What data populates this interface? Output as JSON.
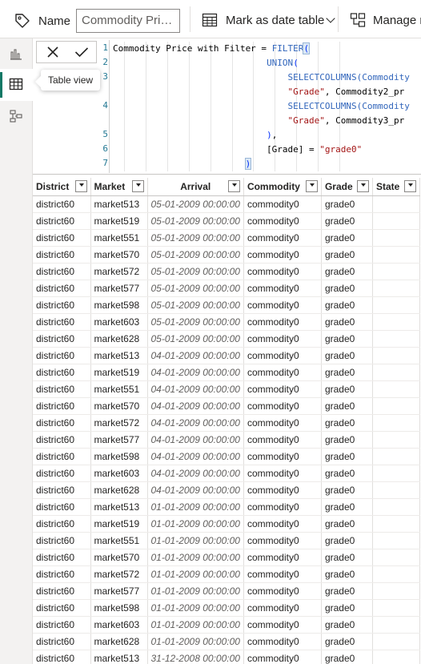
{
  "ribbon": {
    "name_label": "Name",
    "name_value": "Commodity Pri…",
    "mark_date_label": "Mark as date table",
    "manage_label": "Manage r"
  },
  "tooltip": "Table view",
  "formula": {
    "lines": [
      {
        "n": "1",
        "parts": [
          {
            "t": "Commodity Price with Filter = ",
            "c": ""
          },
          {
            "t": "FILTER",
            "c": "fn"
          },
          {
            "t": "(",
            "c": "paren bracket-hl"
          }
        ]
      },
      {
        "n": "2",
        "parts": [
          {
            "t": "                             ",
            "c": ""
          },
          {
            "t": "UNION",
            "c": "fn"
          },
          {
            "t": "(",
            "c": "paren"
          }
        ]
      },
      {
        "n": "3",
        "parts": [
          {
            "t": "                                 ",
            "c": ""
          },
          {
            "t": "SELECTCOLUMNS(Commodity",
            "c": "fn"
          }
        ]
      },
      {
        "n": "",
        "parts": [
          {
            "t": "                                 ",
            "c": ""
          },
          {
            "t": "\"Grade\"",
            "c": "str"
          },
          {
            "t": ", Commodity2_pr",
            "c": ""
          }
        ]
      },
      {
        "n": "4",
        "parts": [
          {
            "t": "                                 ",
            "c": ""
          },
          {
            "t": "SELECTCOLUMNS(Commodity",
            "c": "fn"
          }
        ]
      },
      {
        "n": "",
        "parts": [
          {
            "t": "                                 ",
            "c": ""
          },
          {
            "t": "\"Grade\"",
            "c": "str"
          },
          {
            "t": ", Commodity3_pr",
            "c": ""
          }
        ]
      },
      {
        "n": "5",
        "parts": [
          {
            "t": "                             ",
            "c": ""
          },
          {
            "t": ")",
            "c": "paren"
          },
          {
            "t": ",",
            "c": ""
          }
        ]
      },
      {
        "n": "6",
        "parts": [
          {
            "t": "                             ",
            "c": ""
          },
          {
            "t": "[Grade] = ",
            "c": ""
          },
          {
            "t": "\"grade0\"",
            "c": "str"
          }
        ]
      },
      {
        "n": "7",
        "parts": [
          {
            "t": "                         ",
            "c": ""
          },
          {
            "t": ")",
            "c": "paren bracket-hl"
          }
        ]
      }
    ]
  },
  "table": {
    "columns": [
      "District",
      "Market",
      "Arrival",
      "Commodity",
      "Grade",
      "State"
    ],
    "rows": [
      [
        "district60",
        "market513",
        "05-01-2009 00:00:00",
        "commodity0",
        "grade0",
        ""
      ],
      [
        "district60",
        "market519",
        "05-01-2009 00:00:00",
        "commodity0",
        "grade0",
        ""
      ],
      [
        "district60",
        "market551",
        "05-01-2009 00:00:00",
        "commodity0",
        "grade0",
        ""
      ],
      [
        "district60",
        "market570",
        "05-01-2009 00:00:00",
        "commodity0",
        "grade0",
        ""
      ],
      [
        "district60",
        "market572",
        "05-01-2009 00:00:00",
        "commodity0",
        "grade0",
        ""
      ],
      [
        "district60",
        "market577",
        "05-01-2009 00:00:00",
        "commodity0",
        "grade0",
        ""
      ],
      [
        "district60",
        "market598",
        "05-01-2009 00:00:00",
        "commodity0",
        "grade0",
        ""
      ],
      [
        "district60",
        "market603",
        "05-01-2009 00:00:00",
        "commodity0",
        "grade0",
        ""
      ],
      [
        "district60",
        "market628",
        "05-01-2009 00:00:00",
        "commodity0",
        "grade0",
        ""
      ],
      [
        "district60",
        "market513",
        "04-01-2009 00:00:00",
        "commodity0",
        "grade0",
        ""
      ],
      [
        "district60",
        "market519",
        "04-01-2009 00:00:00",
        "commodity0",
        "grade0",
        ""
      ],
      [
        "district60",
        "market551",
        "04-01-2009 00:00:00",
        "commodity0",
        "grade0",
        ""
      ],
      [
        "district60",
        "market570",
        "04-01-2009 00:00:00",
        "commodity0",
        "grade0",
        ""
      ],
      [
        "district60",
        "market572",
        "04-01-2009 00:00:00",
        "commodity0",
        "grade0",
        ""
      ],
      [
        "district60",
        "market577",
        "04-01-2009 00:00:00",
        "commodity0",
        "grade0",
        ""
      ],
      [
        "district60",
        "market598",
        "04-01-2009 00:00:00",
        "commodity0",
        "grade0",
        ""
      ],
      [
        "district60",
        "market603",
        "04-01-2009 00:00:00",
        "commodity0",
        "grade0",
        ""
      ],
      [
        "district60",
        "market628",
        "04-01-2009 00:00:00",
        "commodity0",
        "grade0",
        ""
      ],
      [
        "district60",
        "market513",
        "01-01-2009 00:00:00",
        "commodity0",
        "grade0",
        ""
      ],
      [
        "district60",
        "market519",
        "01-01-2009 00:00:00",
        "commodity0",
        "grade0",
        ""
      ],
      [
        "district60",
        "market551",
        "01-01-2009 00:00:00",
        "commodity0",
        "grade0",
        ""
      ],
      [
        "district60",
        "market570",
        "01-01-2009 00:00:00",
        "commodity0",
        "grade0",
        ""
      ],
      [
        "district60",
        "market572",
        "01-01-2009 00:00:00",
        "commodity0",
        "grade0",
        ""
      ],
      [
        "district60",
        "market577",
        "01-01-2009 00:00:00",
        "commodity0",
        "grade0",
        ""
      ],
      [
        "district60",
        "market598",
        "01-01-2009 00:00:00",
        "commodity0",
        "grade0",
        ""
      ],
      [
        "district60",
        "market603",
        "01-01-2009 00:00:00",
        "commodity0",
        "grade0",
        ""
      ],
      [
        "district60",
        "market628",
        "01-01-2009 00:00:00",
        "commodity0",
        "grade0",
        ""
      ],
      [
        "district60",
        "market513",
        "31-12-2008 00:00:00",
        "commodity0",
        "grade0",
        ""
      ]
    ]
  },
  "icons": {
    "tag": "tag-icon",
    "calendar": "calendar-table-icon",
    "manage": "manage-relationships-icon",
    "report_view": "bar-chart-icon",
    "table_view": "table-grid-icon",
    "model_view": "model-diagram-icon",
    "cancel": "x-icon",
    "commit": "check-icon"
  },
  "colors": {
    "accent": "#117865",
    "function": "#3165bb",
    "string": "#a31515"
  }
}
